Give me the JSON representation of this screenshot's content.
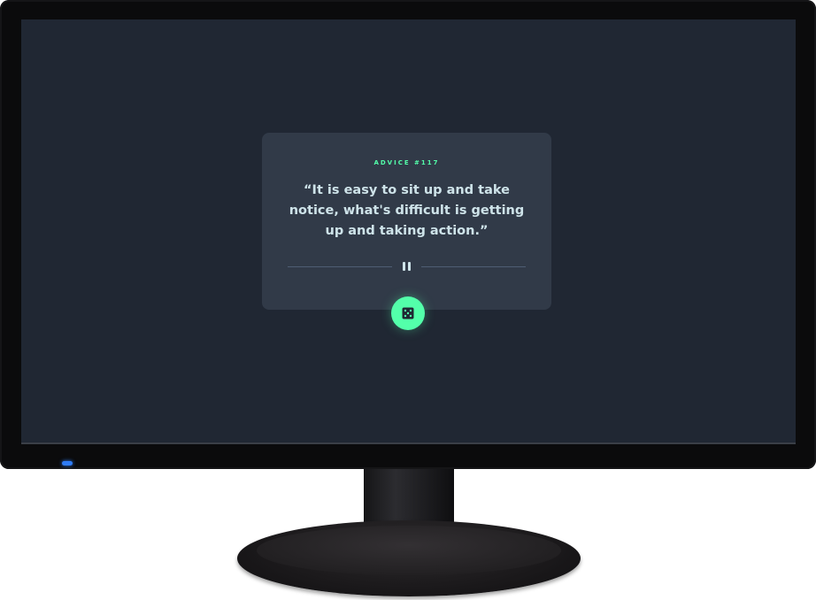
{
  "advice": {
    "label": "ADVICE #117",
    "quote": "“It is easy to sit up and take notice, what's difficult is getting up and taking action.”"
  },
  "icons": {
    "divider": "pause-icon",
    "button": "dice-icon"
  },
  "colors": {
    "screen_background": "#202733",
    "card_background": "#313a48",
    "accent_green": "#53ffaa",
    "text_light": "#cee3e9",
    "divider_line": "#4f5d74",
    "power_led": "#2f7cf6"
  }
}
